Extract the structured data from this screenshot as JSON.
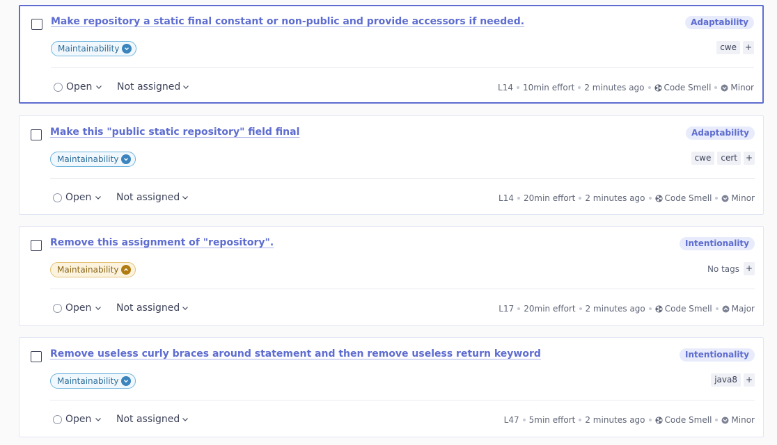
{
  "issues": [
    {
      "title": "Make repository a static final constant or non-public and provide accessors if needed.",
      "attribute": "Adaptability",
      "quality": "Maintainability",
      "quality_level": "blue",
      "tags": [
        "cwe"
      ],
      "no_tags_label": "",
      "tag_add": "+",
      "status": "Open",
      "assignee": "Not assigned",
      "line": "L14",
      "effort": "10min effort",
      "age": "2 minutes ago",
      "type": "Code Smell",
      "severity": "Minor"
    },
    {
      "title": "Make this \"public static repository\" field final",
      "attribute": "Adaptability",
      "quality": "Maintainability",
      "quality_level": "blue",
      "tags": [
        "cwe",
        "cert"
      ],
      "no_tags_label": "",
      "tag_add": "+",
      "status": "Open",
      "assignee": "Not assigned",
      "line": "L14",
      "effort": "20min effort",
      "age": "2 minutes ago",
      "type": "Code Smell",
      "severity": "Minor"
    },
    {
      "title": "Remove this assignment of \"repository\".",
      "attribute": "Intentionality",
      "quality": "Maintainability",
      "quality_level": "yellow",
      "tags": [],
      "no_tags_label": "No tags",
      "tag_add": "+",
      "status": "Open",
      "assignee": "Not assigned",
      "line": "L17",
      "effort": "20min effort",
      "age": "2 minutes ago",
      "type": "Code Smell",
      "severity": "Major"
    },
    {
      "title": "Remove useless curly braces around statement and then remove useless return keyword",
      "attribute": "Intentionality",
      "quality": "Maintainability",
      "quality_level": "blue",
      "tags": [
        "java8"
      ],
      "no_tags_label": "",
      "tag_add": "+",
      "status": "Open",
      "assignee": "Not assigned",
      "line": "L47",
      "effort": "5min effort",
      "age": "2 minutes ago",
      "type": "Code Smell",
      "severity": "Minor"
    }
  ],
  "colors": {
    "accent": "#5d6cd0",
    "selected_border": "#5d6cd0",
    "maintainability_low": "#3b84bd",
    "maintainability_medium": "#b07b12"
  },
  "icons": {
    "type": "code-smell-icon",
    "severity_minor": "minor-severity-icon",
    "severity_major": "major-severity-icon",
    "dropdown": "chevron-down-icon"
  }
}
